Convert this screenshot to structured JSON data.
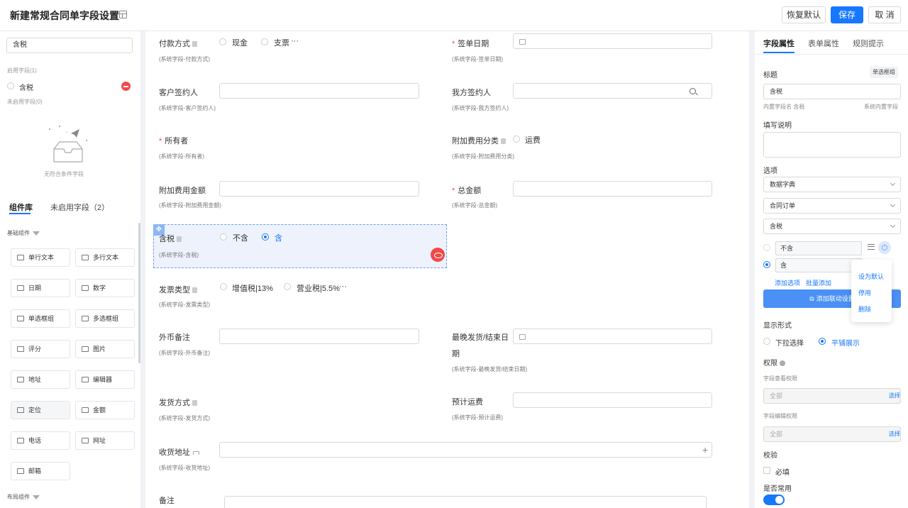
{
  "header": {
    "title": "新建常规合同单字段设置",
    "restore_label": "恢复默认",
    "save_label": "保存",
    "cancel_label": "取 消"
  },
  "left": {
    "search_value": "含税",
    "enabled_label": "启用字段(1)",
    "enabled_item": "含税",
    "disabled_label": "未启用字段(0)",
    "empty_text": "无符合条件字段",
    "tab_components": "组件库",
    "tab_unused": "未启用字段（2）",
    "group_basic": "基础组件",
    "group_layout": "布局组件",
    "components": [
      {
        "label": "单行文本",
        "icon": "single-line-text-icon"
      },
      {
        "label": "多行文本",
        "icon": "multi-line-text-icon"
      },
      {
        "label": "日期",
        "icon": "date-icon"
      },
      {
        "label": "数字",
        "icon": "number-icon"
      },
      {
        "label": "单选框组",
        "icon": "radio-group-icon"
      },
      {
        "label": "多选框组",
        "icon": "checkbox-group-icon"
      },
      {
        "label": "评分",
        "icon": "star-icon"
      },
      {
        "label": "图片",
        "icon": "image-icon"
      },
      {
        "label": "地址",
        "icon": "location-pin-icon"
      },
      {
        "label": "编辑器",
        "icon": "editor-icon"
      },
      {
        "label": "定位",
        "icon": "locate-icon"
      },
      {
        "label": "金额",
        "icon": "money-icon"
      },
      {
        "label": "电话",
        "icon": "phone-icon"
      },
      {
        "label": "网址",
        "icon": "globe-icon"
      },
      {
        "label": "邮箱",
        "icon": "mail-icon"
      }
    ]
  },
  "canvas": {
    "fields": [
      {
        "label": "付款方式",
        "hint": "(系统字段-付款方式)",
        "options": [
          "现金",
          "支票"
        ],
        "more": "···"
      },
      {
        "label": "签单日期",
        "hint": "(系统字段-签单日期)"
      },
      {
        "label": "客户签约人",
        "hint": "(系统字段-客户签约人)"
      },
      {
        "label": "我方签约人",
        "hint": "(系统字段-我方签约人)"
      },
      {
        "label": "所有者",
        "hint": "(系统字段-所有者)"
      },
      {
        "label": "附加费用分类",
        "hint": "(系统字段-附加费用分类)",
        "options": [
          "运费"
        ]
      },
      {
        "label": "附加费用金额",
        "hint": "(系统字段-附加费用金额)"
      },
      {
        "label": "总金额",
        "hint": "(系统字段-总金额)"
      },
      {
        "label": "含税",
        "hint": "(系统字段-含税)",
        "options": [
          "不含",
          "含"
        ]
      },
      {
        "label": "发票类型",
        "hint": "(系统字段-发票类型)",
        "options": [
          "增值税|13%",
          "营业税|5.5%"
        ],
        "more": "···"
      },
      {
        "label": "外币备注",
        "hint": "(系统字段-外币备注)"
      },
      {
        "label": "最晚发货/结束日",
        "label2": "期",
        "hint": "(系统字段-最晚发货/结束日期)"
      },
      {
        "label": "发货方式",
        "hint": "(系统字段-发货方式)"
      },
      {
        "label": "预计运费",
        "hint": "(系统字段-预计运费)"
      },
      {
        "label": "收货地址",
        "hint": "(系统字段-收货地址)"
      },
      {
        "label": "备注"
      }
    ]
  },
  "right": {
    "tabs": [
      "字段属性",
      "表单属性",
      "规则提示"
    ],
    "title_label": "标题",
    "type_tag": "单选框组",
    "title_value": "含税",
    "builtin_name": "内置字段名 含税",
    "builtin_type": "系统内置字段",
    "desc_label": "填写说明",
    "options_label": "选项",
    "source_select": "数据字典",
    "dict_select": "合同订单",
    "item_select": "含税",
    "option_values": [
      "不含",
      "含"
    ],
    "add_option": "添加选项",
    "batch_add": "批量添加",
    "add_linkage": "添加联动设置",
    "menu": [
      "设为默认",
      "停用",
      "删除"
    ],
    "display_label": "显示形式",
    "display_options": [
      "下拉选择",
      "平铺展示"
    ],
    "permission_label": "权限",
    "view_perm_label": "字段查看权限",
    "view_perm_value": "全部",
    "edit_perm_label": "字段编辑权限",
    "edit_perm_value": "全部",
    "choose": "选择",
    "validate_label": "校验",
    "required_label": "必填",
    "common_label": "是否常用"
  }
}
